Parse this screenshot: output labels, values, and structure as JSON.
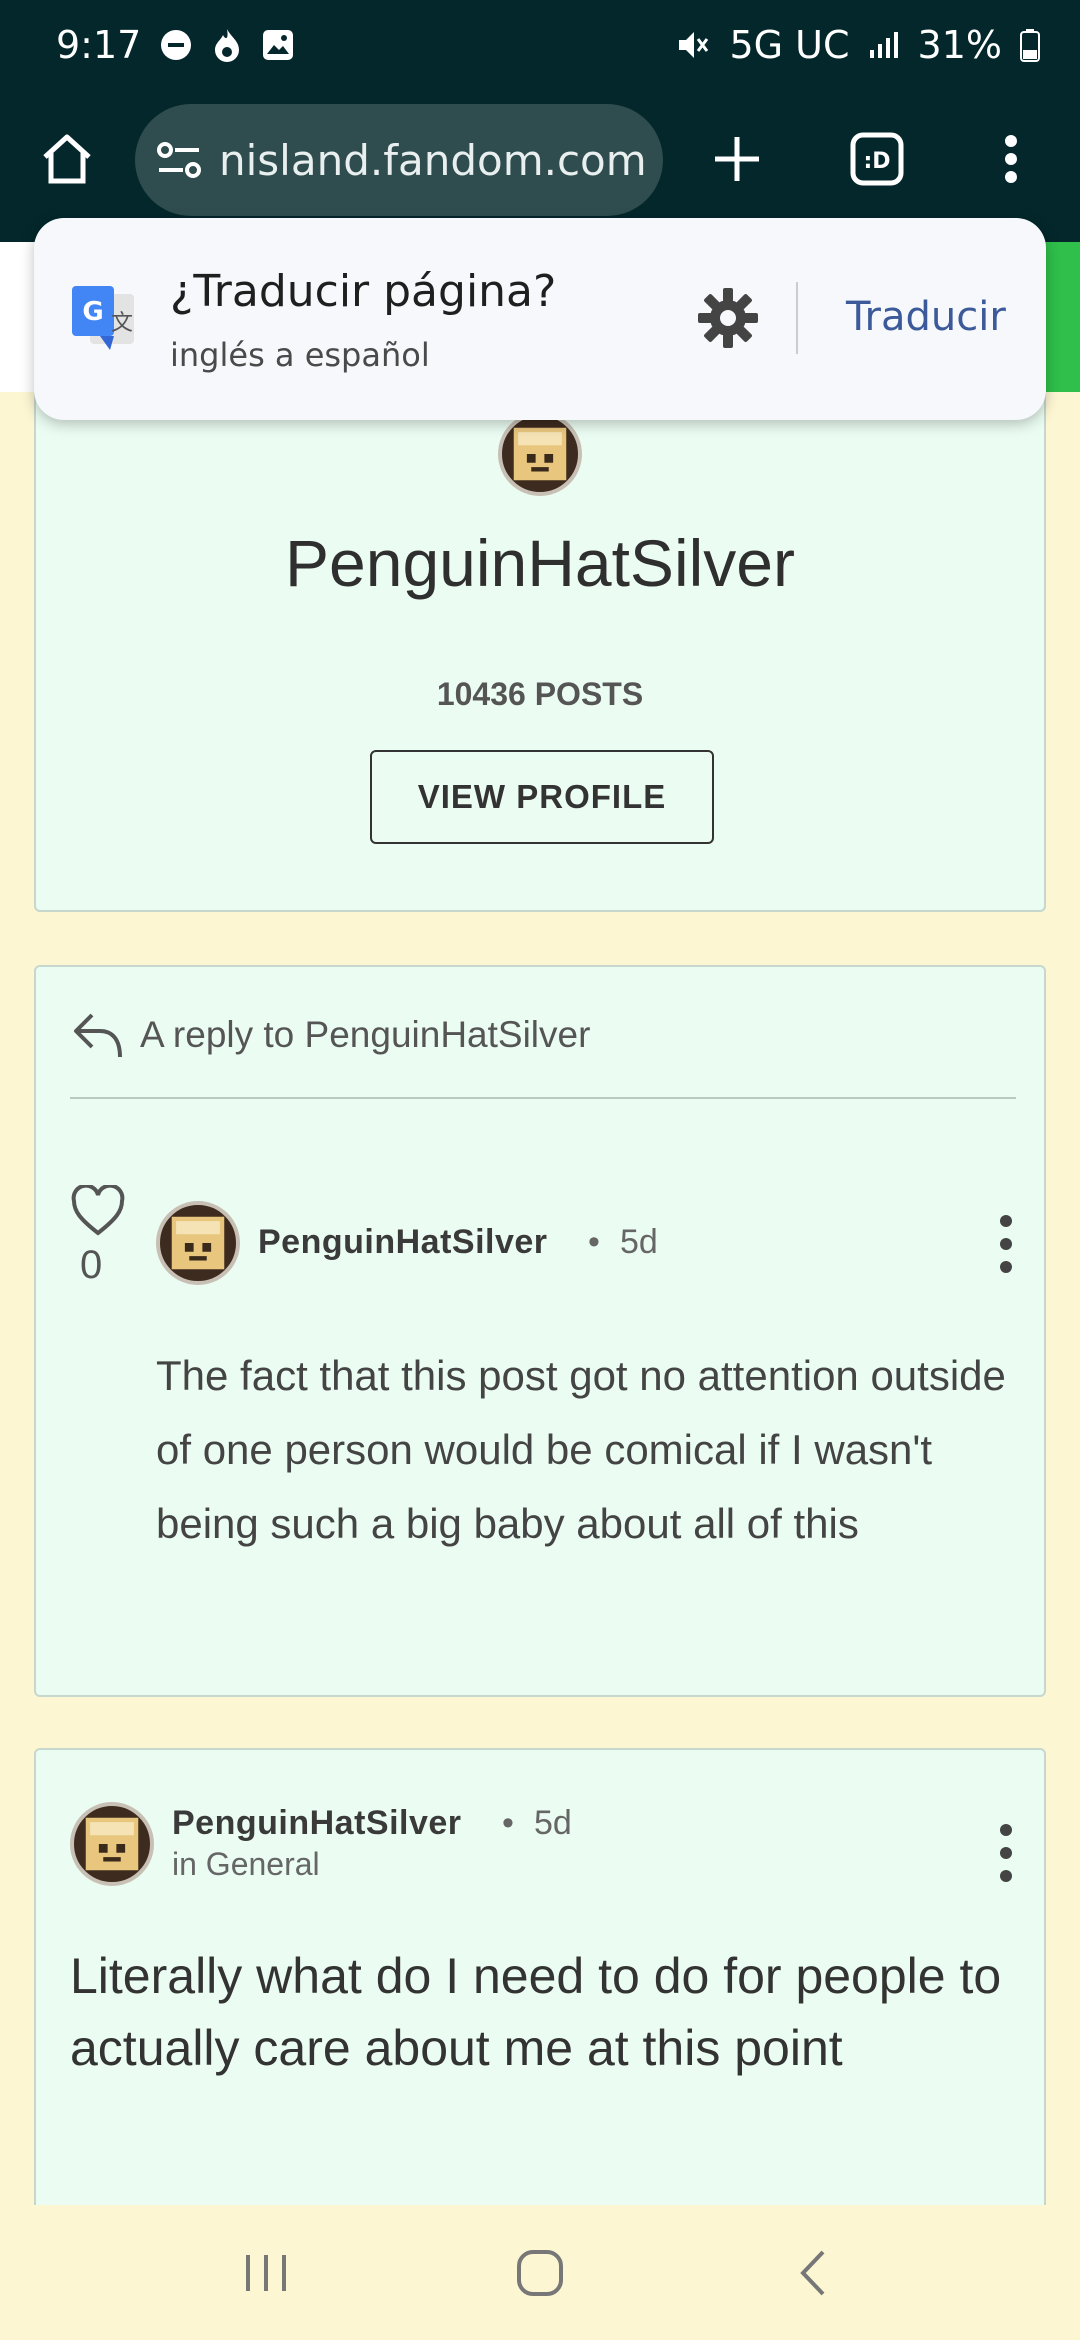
{
  "status_bar": {
    "time": "9:17",
    "network": "5G UC",
    "battery": "31%"
  },
  "browser": {
    "url": "nisland.fandom.com",
    "url_prefix": "n"
  },
  "translate_popup": {
    "title": "¿Traducir página?",
    "subtitle": "inglés a español",
    "translate_label": "Traducir"
  },
  "profile": {
    "name": "PenguinHatSilver",
    "posts": "10436 POSTS",
    "view_profile_label": "VIEW PROFILE"
  },
  "reply_card": {
    "header": "A reply to PenguinHatSilver",
    "likes": "0",
    "author": "PenguinHatSilver",
    "separator": "•",
    "time": "5d",
    "body": "The fact that this post got no attention outside of one person would be comical if I wasn't being such a big baby about all of this"
  },
  "general_card": {
    "author": "PenguinHatSilver",
    "separator": "•",
    "time": "5d",
    "category": "in General",
    "body": "Literally what do I need to do for people to actually care about me at this point"
  },
  "colors": {
    "status_bg": "#03272b",
    "card_bg": "#ebfdf3",
    "page_bg": "#fdf6d3",
    "translate_accent": "#3c5a99"
  }
}
